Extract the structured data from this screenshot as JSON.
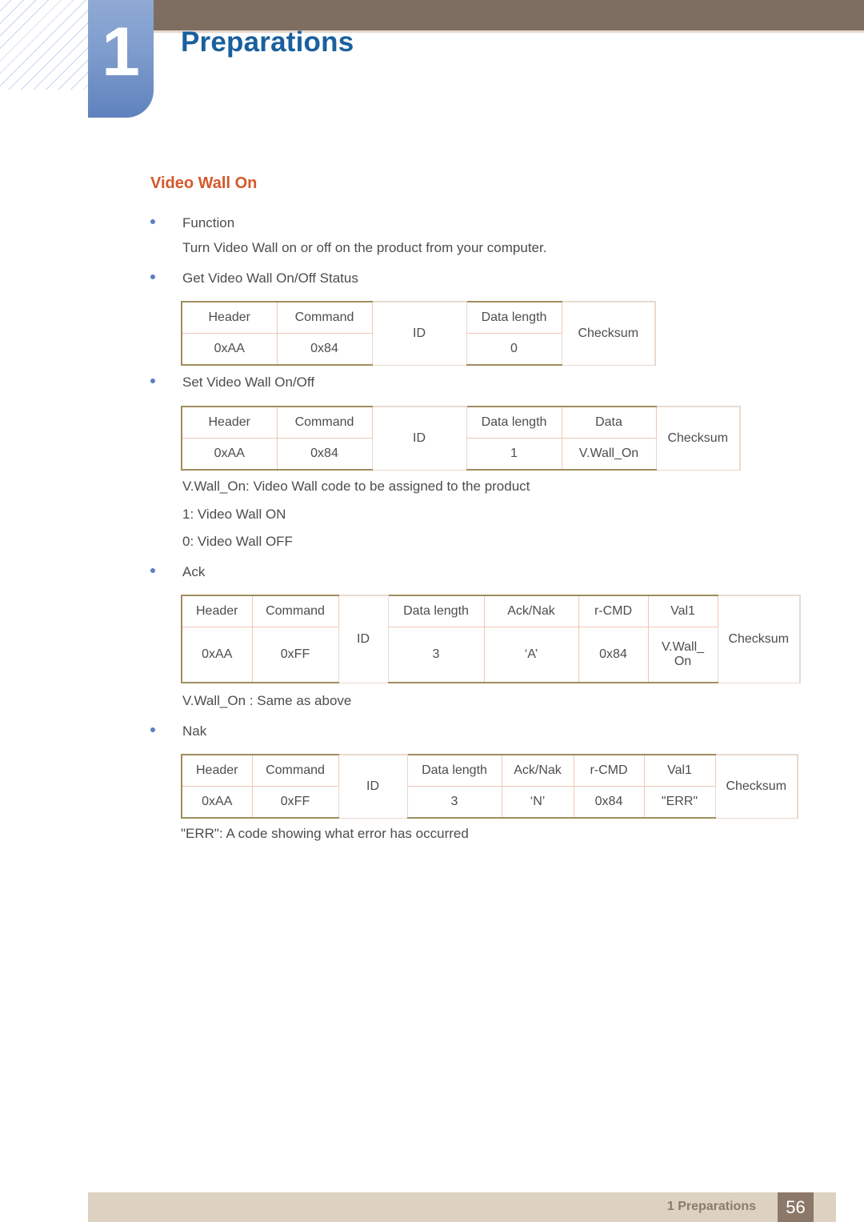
{
  "header": {
    "chapter_number": "1",
    "chapter_title": "Preparations"
  },
  "section": {
    "title": "Video Wall On"
  },
  "body": {
    "bullet_function": "Function",
    "function_description": "Turn Video Wall on or off on the product from your computer.",
    "bullet_get_status": "Get Video Wall On/Off Status",
    "bullet_set": "Set Video Wall On/Off",
    "note_vwallon": "V.Wall_On: Video Wall code to be assigned to the product",
    "note_on": "1: Video Wall ON",
    "note_off": "0: Video Wall OFF",
    "bullet_ack": "Ack",
    "note_same_as_above": "V.Wall_On : Same as above",
    "bullet_nak": "Nak",
    "note_err": "\"ERR\": A code showing what error has occurred"
  },
  "tables": {
    "get_status": {
      "headers": [
        "Header",
        "Command",
        "ID",
        "Data length",
        "Checksum"
      ],
      "values": [
        "0xAA",
        "0x84",
        "",
        "0",
        ""
      ]
    },
    "set": {
      "headers": [
        "Header",
        "Command",
        "ID",
        "Data length",
        "Data",
        "Checksum"
      ],
      "values": [
        "0xAA",
        "0x84",
        "",
        "1",
        "V.Wall_On",
        ""
      ]
    },
    "ack": {
      "headers": [
        "Header",
        "Command",
        "ID",
        "Data length",
        "Ack/Nak",
        "r-CMD",
        "Val1",
        "Checksum"
      ],
      "values": [
        "0xAA",
        "0xFF",
        "",
        "3",
        "‘A’",
        "0x84",
        "V.Wall_\nOn",
        ""
      ]
    },
    "nak": {
      "headers": [
        "Header",
        "Command",
        "ID",
        "Data length",
        "Ack/Nak",
        "r-CMD",
        "Val1",
        "Checksum"
      ],
      "values": [
        "0xAA",
        "0xFF",
        "",
        "3",
        "‘N’",
        "0x84",
        "\"ERR\"",
        ""
      ]
    }
  },
  "footer": {
    "label": "1 Preparations",
    "page": "56"
  },
  "colors": {
    "accent_orange": "#d4582b",
    "chapter_blue": "#19609e",
    "badge_blue": "#7e9ccd",
    "band_brown": "#7d6e61",
    "footer_bar": "#ddd2c1",
    "footer_page": "#8b7868",
    "table_outer_border": "#a08d5e",
    "table_inner_border": "#efc9b8"
  }
}
